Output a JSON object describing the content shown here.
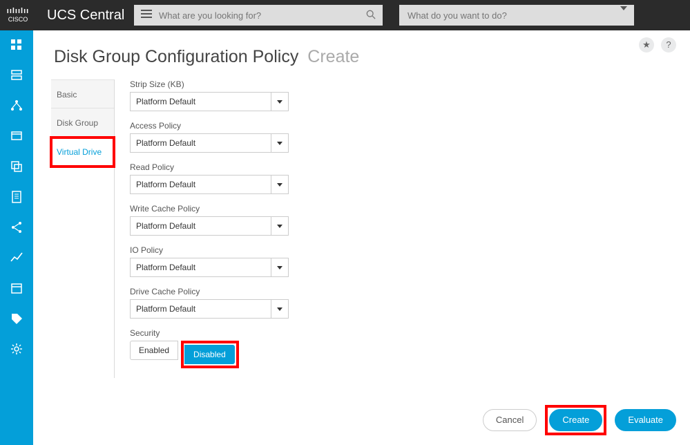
{
  "app_name": "UCS Central",
  "search": {
    "placeholder": "What are you looking for?"
  },
  "action_search": {
    "placeholder": "What do you want to do?"
  },
  "page": {
    "title": "Disk Group Configuration Policy",
    "mode": "Create"
  },
  "leftnav_icons": [
    "dashboard-icon",
    "server-icon",
    "topology-icon",
    "window-icon",
    "clone-icon",
    "doc-icon",
    "share-icon",
    "graph-icon",
    "calendar-icon",
    "tag-icon",
    "gear-icon"
  ],
  "side_tabs": {
    "items": [
      {
        "label": "Basic",
        "active": false
      },
      {
        "label": "Disk Group",
        "active": false
      },
      {
        "label": "Virtual Drive",
        "active": true,
        "highlight": true
      }
    ]
  },
  "fields": {
    "strip_size": {
      "label": "Strip Size (KB)",
      "value": "Platform Default"
    },
    "access": {
      "label": "Access Policy",
      "value": "Platform Default"
    },
    "read": {
      "label": "Read Policy",
      "value": "Platform Default"
    },
    "write_cache": {
      "label": "Write Cache Policy",
      "value": "Platform Default"
    },
    "io": {
      "label": "IO Policy",
      "value": "Platform Default"
    },
    "drive_cache": {
      "label": "Drive Cache Policy",
      "value": "Platform Default"
    },
    "security": {
      "label": "Security",
      "enabled_label": "Enabled",
      "disabled_label": "Disabled",
      "selected": "Disabled",
      "highlight": true
    }
  },
  "buttons": {
    "cancel": "Cancel",
    "create": "Create",
    "evaluate": "Evaluate",
    "create_highlight": true
  },
  "badges": {
    "star": "★",
    "help": "?"
  }
}
